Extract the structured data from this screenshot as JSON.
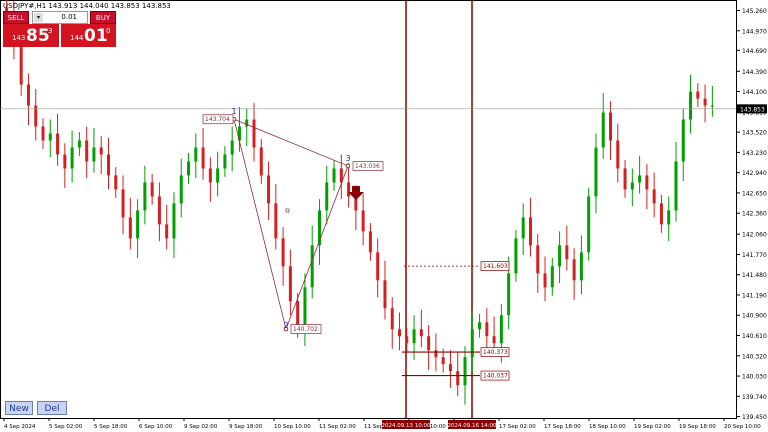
{
  "symbol_info": "USDJPY#,H1  143.913 144.040 143.853 143.853",
  "trade_panel": {
    "sell_label": "SELL",
    "buy_label": "BUY",
    "lot": "0.01",
    "sell_price": {
      "prefix": "143",
      "big": "85",
      "sup": "3"
    },
    "buy_price": {
      "prefix": "144",
      "big": "01",
      "sup": "0"
    }
  },
  "buttons": {
    "new": "New",
    "del": "Del"
  },
  "colors": {
    "bull": "#00a000",
    "bear": "#d42020",
    "accent": "#8b0000",
    "pattern": "#8b2a3a",
    "panel_red": "#d3131f"
  },
  "price_axis": {
    "min": 139.43,
    "max": 145.41,
    "ticks": [
      "145.260",
      "144.970",
      "144.690",
      "144.390",
      "144.100",
      "143.810",
      "143.520",
      "143.230",
      "142.940",
      "142.650",
      "142.360",
      "142.060",
      "141.770",
      "141.480",
      "141.190",
      "140.900",
      "140.610",
      "140.320",
      "140.030",
      "139.740",
      "139.450"
    ],
    "current": "143.853"
  },
  "time_axis": {
    "labels": [
      "4 Sep 2024",
      "5 Sep 02:00",
      "5 Sep 18:00",
      "6 Sep 10:00",
      "9 Sep 02:00",
      "9 Sep 18:00",
      "10 Sep 10:00",
      "11 Sep 02:00",
      "11 Sep 18:00",
      "12 Sep 10:00",
      "Sep 18:00",
      "17 Sep 02:00",
      "17 Sep 18:00",
      "18 Sep 10:00",
      "19 Sep 02:00",
      "19 Sep 18:00",
      "20 Sep 10:00"
    ],
    "highlight": [
      "2024.09.13 10:00",
      "2024.09.16 14:00"
    ]
  },
  "pattern": {
    "points": [
      {
        "label": "1",
        "price": 143.704
      },
      {
        "label": "2",
        "price": 140.702
      },
      {
        "label": "3",
        "price": 143.036
      }
    ],
    "labels": [
      "143.704",
      "140.702",
      "143.036"
    ]
  },
  "levels": [
    "141.603",
    "140.373",
    "140.037"
  ],
  "chart_data": {
    "type": "candlestick",
    "series": [
      {
        "values": [
          145.2,
          144.8,
          144.2,
          143.9,
          143.6,
          143.4,
          143.5,
          143.2,
          143.0,
          143.3,
          143.4,
          143.1,
          143.3,
          143.2,
          142.9,
          142.7,
          142.3,
          142.0,
          142.4,
          142.8,
          142.6,
          142.2,
          142.0,
          142.5,
          142.9,
          143.1,
          143.3,
          143.0,
          142.8,
          143.0,
          143.2,
          143.4,
          143.6,
          143.7,
          143.3,
          142.9,
          142.5,
          142.0,
          141.6,
          141.1,
          140.7,
          141.3,
          141.9,
          142.4,
          142.8,
          143.0,
          142.8,
          142.6,
          142.4,
          142.1,
          141.8,
          141.4,
          141.0,
          140.7,
          140.6,
          140.5,
          140.7,
          140.6,
          140.4,
          140.3,
          140.2,
          140.1,
          139.9,
          140.3,
          140.7,
          140.8,
          140.6,
          140.5,
          140.9,
          141.5,
          142.0,
          142.3,
          141.9,
          141.5,
          141.3,
          141.6,
          141.9,
          141.7,
          141.4,
          141.8,
          142.6,
          143.3,
          143.8,
          143.4,
          143.0,
          142.7,
          142.8,
          142.9,
          142.7,
          142.5,
          142.2,
          142.4,
          143.1,
          143.7,
          144.1,
          144.0,
          143.9,
          143.9
        ]
      }
    ],
    "ylim": [
      139.43,
      145.41
    ],
    "title": ""
  }
}
